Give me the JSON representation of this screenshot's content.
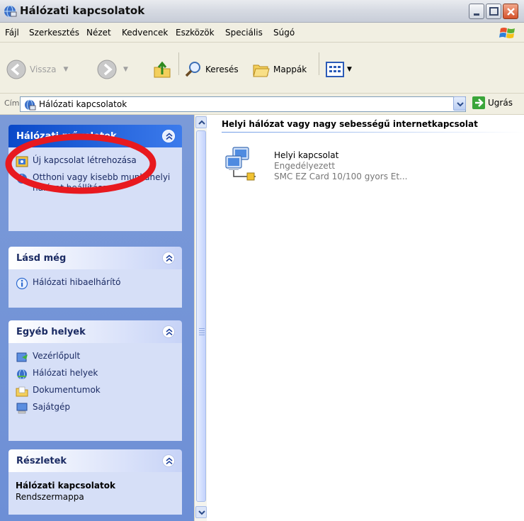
{
  "window": {
    "title": "Hálózati kapcsolatok"
  },
  "menubar": {
    "items": [
      "Fájl",
      "Szerkesztés",
      "Nézet",
      "Kedvencek",
      "Eszközök",
      "Speciális",
      "Súgó"
    ]
  },
  "toolbar": {
    "back_label": "Vissza",
    "search_label": "Keresés",
    "folders_label": "Mappák"
  },
  "address": {
    "label": "Cím",
    "value": "Hálózati kapcsolatok",
    "go_label": "Ugrás"
  },
  "sidebar": {
    "network_tasks": {
      "title": "Hálózati műveletek",
      "items": [
        {
          "label": "Új kapcsolat létrehozása",
          "icon": "new-connection-icon"
        },
        {
          "label": "Otthoni vagy kisebb munkahelyi hálózat beállítása",
          "icon": "home-network-icon"
        }
      ]
    },
    "see_also": {
      "title": "Lásd még",
      "items": [
        {
          "label": "Hálózati hibaelhárító",
          "icon": "info-icon"
        }
      ]
    },
    "other_places": {
      "title": "Egyéb helyek",
      "items": [
        {
          "label": "Vezérlőpult",
          "icon": "control-panel-icon"
        },
        {
          "label": "Hálózati helyek",
          "icon": "network-places-icon"
        },
        {
          "label": "Dokumentumok",
          "icon": "documents-folder-icon"
        },
        {
          "label": "Sajátgép",
          "icon": "my-computer-icon"
        }
      ]
    },
    "details": {
      "title": "Részletek",
      "name": "Hálózati kapcsolatok",
      "type": "Rendszermappa"
    }
  },
  "content": {
    "group_title": "Helyi hálózat vagy nagy sebességű internetkapcsolat",
    "connections": [
      {
        "name": "Helyi kapcsolat",
        "status": "Engedélyezett",
        "device": "SMC EZ Card 10/100 gyors Et..."
      }
    ]
  },
  "colors": {
    "sidebar_bg": "#6d8fd6",
    "panel_body": "#d6dff7",
    "special_header": "#0a49c8",
    "annotation": "#e8191f"
  }
}
